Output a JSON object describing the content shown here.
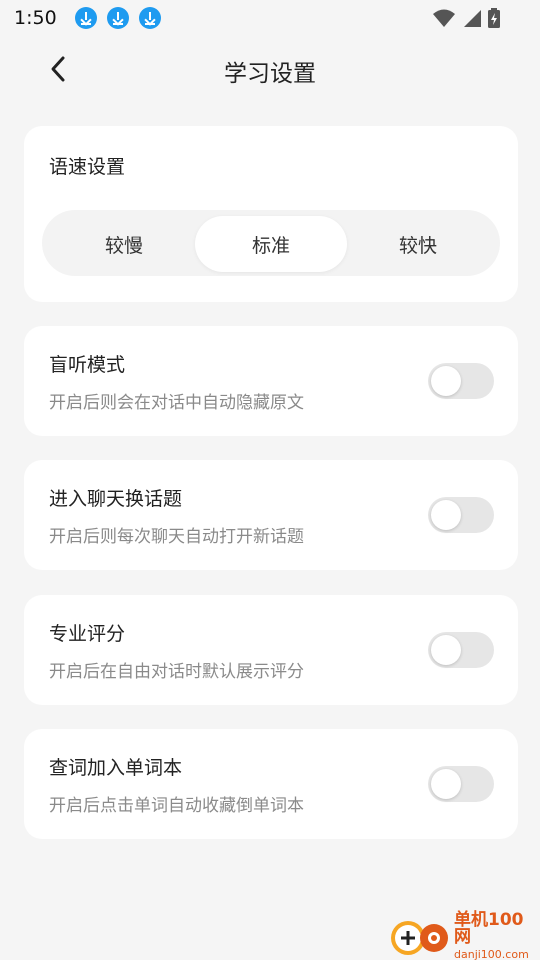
{
  "status_bar": {
    "time": "1:50",
    "notification_icons": [
      "download-icon",
      "download-icon",
      "download-icon"
    ],
    "right_icons": [
      "wifi-icon",
      "cell-signal-icon",
      "battery-charging-icon"
    ]
  },
  "header": {
    "title": "学习设置",
    "back_icon": "chevron-left-icon"
  },
  "speed": {
    "title": "语速设置",
    "options": [
      "较慢",
      "标准",
      "较快"
    ],
    "selected": "标准"
  },
  "settings": [
    {
      "title": "盲听模式",
      "description": "开启后则会在对话中自动隐藏原文",
      "enabled": false
    },
    {
      "title": "进入聊天换话题",
      "description": "开启后则每次聊天自动打开新话题",
      "enabled": false
    },
    {
      "title": "专业评分",
      "description": "开启后在自由对话时默认展示评分",
      "enabled": false
    },
    {
      "title": "查词加入单词本",
      "description": "开启后点击单词自动收藏倒单词本",
      "enabled": false
    }
  ],
  "watermark": {
    "name": "单机100网",
    "url": "danji100.com"
  },
  "colors": {
    "background": "#f5f5f5",
    "card": "#ffffff",
    "toggle_off": "#e6e6e6",
    "download_badge": "#1e9bf0",
    "watermark": "#e05a1a"
  }
}
